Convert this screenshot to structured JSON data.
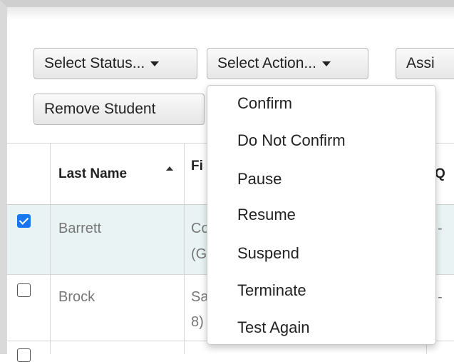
{
  "toolbar": {
    "select_status": "Select Status...",
    "select_action": "Select Action...",
    "assign_partial": "Assi",
    "remove_student": "Remove Student"
  },
  "table": {
    "headers": {
      "last_name": "Last Name",
      "first_partial": "Fi",
      "q_partial": "Q"
    },
    "rows": [
      {
        "checked": true,
        "last_name": "Barrett",
        "first_line1": "Co",
        "first_line2": "(G",
        "q": "-"
      },
      {
        "checked": false,
        "last_name": "Brock",
        "first_line1": "Sa",
        "first_line2": "8)",
        "q": "-"
      }
    ]
  },
  "action_menu": {
    "items": [
      "Confirm",
      "Do Not Confirm",
      "Pause",
      "Resume",
      "Suspend",
      "Terminate",
      "Test Again"
    ]
  },
  "colors": {
    "checkbox_checked": "#1976f0",
    "selected_row_bg": "#eaf3f3"
  }
}
